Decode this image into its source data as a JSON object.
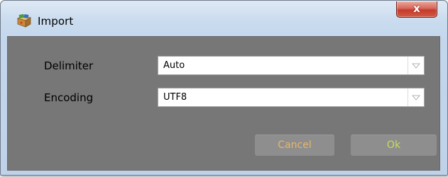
{
  "window": {
    "title": "Import",
    "close_glyph": "x"
  },
  "icons": {
    "app": "import-app-icon",
    "close": "close-icon",
    "dropdown": "chevron-down-icon"
  },
  "form": {
    "delimiter": {
      "label": "Delimiter",
      "value": "Auto"
    },
    "encoding": {
      "label": "Encoding",
      "value": "UTF8"
    }
  },
  "buttons": {
    "cancel_label": "Cancel",
    "ok_label": "Ok"
  },
  "colors": {
    "content_bg": "#777777",
    "button_bg": "#8e8e8e",
    "cancel_text": "#e8b56a",
    "ok_text": "#c7dc5c",
    "close_button": "#c43b2b"
  }
}
